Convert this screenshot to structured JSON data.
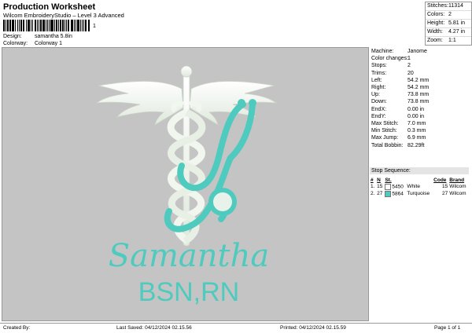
{
  "header": {
    "title": "Production Worksheet",
    "subtitle": "Wilcom EmbroideryStudio – Level 3 Advanced",
    "barcode_suffix": "1",
    "design_label": "Design:",
    "design_value": "samantha 5.8in",
    "colorway_label": "Colorway:",
    "colorway_value": "Colorway 1"
  },
  "stats": [
    {
      "label": "Stitches:",
      "value": "11314"
    },
    {
      "label": "Colors:",
      "value": "2"
    },
    {
      "label": "Height:",
      "value": "5.81 in"
    },
    {
      "label": "Width:",
      "value": "4.27 in"
    },
    {
      "label": "Zoom:",
      "value": "1:1"
    }
  ],
  "design": {
    "name_text": "Samantha",
    "credentials_text": "BSN,RN",
    "white_color": "#f1f7ee",
    "turquoise_color": "#4ecbbe",
    "canvas_color": "#c4c4c4"
  },
  "machine_info": [
    {
      "label": "Machine:",
      "value": "Janome"
    },
    {
      "label": "Color changes:",
      "value": "1"
    },
    {
      "label": "Stops:",
      "value": "2"
    },
    {
      "label": "Trims:",
      "value": "20"
    },
    {
      "label": "Left:",
      "value": "54.2 mm"
    },
    {
      "label": "Right:",
      "value": "54.2 mm"
    },
    {
      "label": "Up:",
      "value": "73.8 mm"
    },
    {
      "label": "Down:",
      "value": "73.8 mm"
    },
    {
      "label": "EndX:",
      "value": "0.00 in"
    },
    {
      "label": "EndY:",
      "value": "0.00 in"
    },
    {
      "label": "Max Stitch:",
      "value": "7.0 mm"
    },
    {
      "label": "Min Stitch:",
      "value": "0.3 mm"
    },
    {
      "label": "Max Jump:",
      "value": "6.9 mm"
    },
    {
      "label": "Total Bobbin:",
      "value": "82.29ft"
    }
  ],
  "stop_sequence": {
    "title": "Stop Sequence:",
    "columns": [
      "#",
      "N",
      "St.",
      "Code",
      "Brand"
    ],
    "rows": [
      {
        "num": "1.",
        "n": "15",
        "st": "5450",
        "color_name": "White",
        "code": "15",
        "brand": "Wilcom",
        "swatch": "#ffffff"
      },
      {
        "num": "2.",
        "n": "27",
        "st": "5864",
        "color_name": "Turquoise",
        "code": "27",
        "brand": "Wilcom",
        "swatch": "#4ecbbe"
      }
    ]
  },
  "footer": {
    "created_by": "Created By:",
    "last_saved": "Last Saved: 04/12/2024 02.15.56",
    "printed": "Printed: 04/12/2024 02.15.59",
    "page": "Page 1 of 1"
  }
}
